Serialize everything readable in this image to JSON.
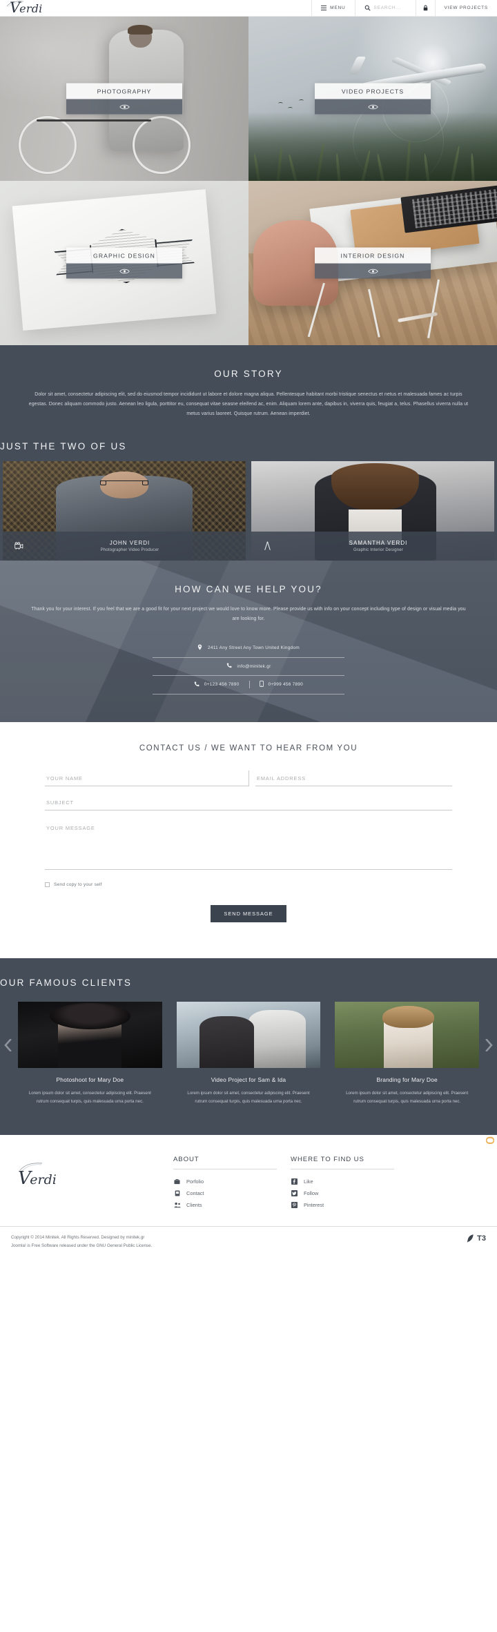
{
  "header": {
    "brand": "Verdi",
    "brand_initial": "V",
    "brand_rest": "erdi",
    "menu_label": "MENU",
    "search_placeholder": "SEARCH...",
    "lock_icon": "lock-icon",
    "view_projects_label": "VIEW PROJECTS"
  },
  "tiles": [
    {
      "label": "PHOTOGRAPHY",
      "icon": "eye-icon"
    },
    {
      "label": "VIDEO PROJECTS",
      "icon": "eye-icon"
    },
    {
      "label": "GRAPHIC DESIGN",
      "icon": "eye-icon"
    },
    {
      "label": "INTERIOR DESIGN",
      "icon": "eye-icon"
    }
  ],
  "story": {
    "title": "OUR STORY",
    "body": "Dolor sit amet, consectetur adipiscing elit, sed do eiusmod tempor incididunt ut labore et dolore magna aliqua. Pellentesque habitant morbi tristique senectus et netus et malesuada fames ac turpis egestas. Donec aliquam commodo justo. Aenean leo ligula, porttitor eu, consequat vitae seasne eleifend ac, enim. Aliquam lorem ante, dapibus in, viverra quis, feugiat a, telus. Phasellus viverra nulla ut metus varius laoreet. Quisque rutrum. Aenean imperdiet."
  },
  "team": {
    "title": "JUST THE TWO OF US",
    "members": [
      {
        "name": "JOHN VERDI",
        "role": "Photographer Video Producer",
        "icon": "camera-icon"
      },
      {
        "name": "SAMANTHA VERDI",
        "role": "Graphic Interior Designer",
        "icon": "compass-icon"
      }
    ]
  },
  "help": {
    "title": "HOW CAN WE HELP YOU?",
    "lead": "Thank you for your interest. If you feel that we are a good fit for your next project we would love to know more. Please provide us with info on your concept including type of design or visual media you are looking for.",
    "address": "2411 Any Street Any Town United Kingdom",
    "address_icon": "map-pin-icon",
    "email": "info@minitek.gr",
    "email_icon": "phone-icon",
    "phone1": "0+123 456 7890",
    "phone1_icon": "phone-icon",
    "phone2": "0+999 456 7890",
    "phone2_icon": "mobile-icon"
  },
  "contact_form": {
    "title": "CONTACT US / WE WANT TO HEAR FROM YOU",
    "name_placeholder": "YOUR NAME",
    "name_value": "",
    "email_placeholder": "EMAIL ADDRESS",
    "email_value": "",
    "subject_placeholder": "SUBJECT",
    "subject_value": "",
    "message_placeholder": "YOUR MESSAGE",
    "message_value": "",
    "copy_label": "Send copy to your self",
    "copy_checked": false,
    "submit_label": "SEND MESSAGE"
  },
  "clients": {
    "title": "OUR FAMOUS CLIENTS",
    "prev_icon": "chevron-left-icon",
    "next_icon": "chevron-right-icon",
    "items": [
      {
        "title": "Photoshoot for Mary Doe",
        "text": "Lorem ipsum dolor sit amet, consectetur adipiscing elit. Praesent rutrum consequat turpis, quis malesuada urna porta nec."
      },
      {
        "title": "Video Project for Sam & Ida",
        "text": "Lorem ipsum dolor sit amet, consectetur adipiscing elit. Praesent rutrum consequat turpis, quis malesuada urna porta nec."
      },
      {
        "title": "Branding for Mary Doe",
        "text": "Lorem ipsum dolor sit amet, consectetur adipiscing elit. Praesent rutrum consequat turpis, quis malesuada urna porta nec."
      }
    ]
  },
  "footer": {
    "brand_initial": "V",
    "brand_rest": "erdi",
    "about": {
      "title": "ABOUT",
      "items": [
        {
          "label": "Porfolio",
          "icon": "briefcase-icon"
        },
        {
          "label": "Contact",
          "icon": "contact-card-icon"
        },
        {
          "label": "Clients",
          "icon": "users-icon"
        }
      ]
    },
    "social": {
      "title": "WHERE TO FIND US",
      "items": [
        {
          "label": "Like",
          "icon": "facebook-icon"
        },
        {
          "label": "Follow",
          "icon": "twitter-icon"
        },
        {
          "label": "Pinterest",
          "icon": "pinterest-icon"
        }
      ]
    },
    "copyright_line1": "Copyright © 2014 Minitek. All Rights Reserved. Designed by minitek.gr",
    "copyright_line2": "Joomla! is Free Software released under the GNU General Public License.",
    "badge": "T3",
    "close_icon": "close-icon"
  },
  "colors": {
    "dark_panel": "#454d59",
    "mid_panel": "#5c6572",
    "button": "#3b434e",
    "accent_orange": "#e9a23b"
  }
}
